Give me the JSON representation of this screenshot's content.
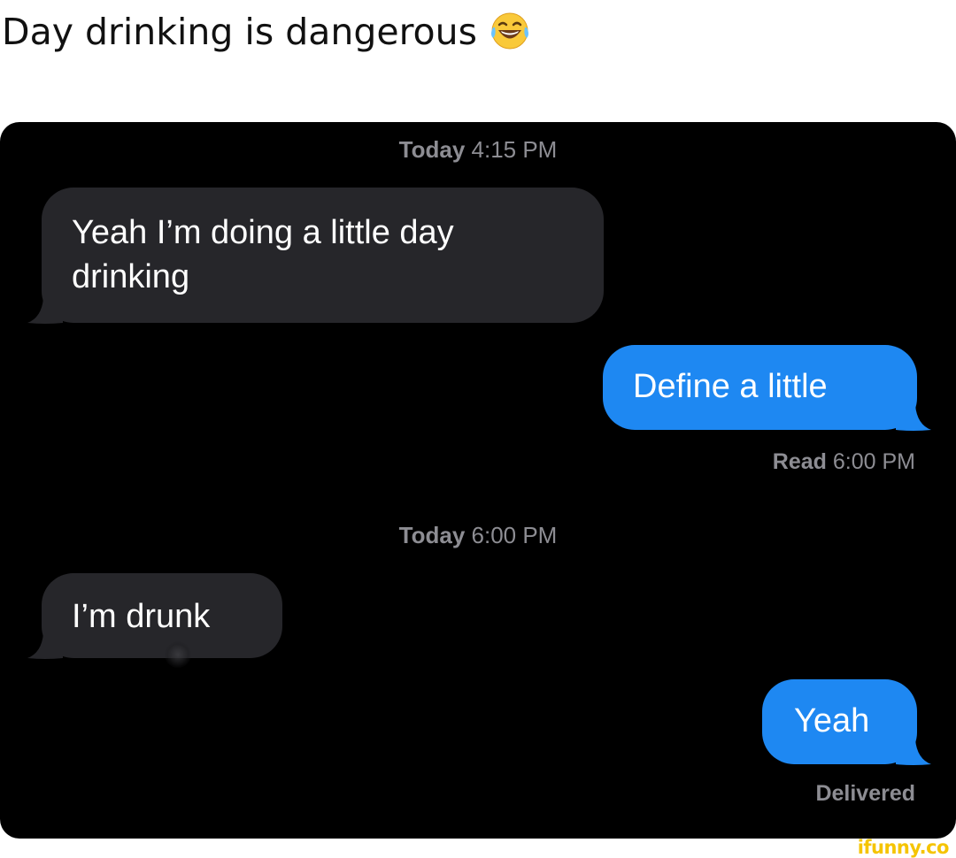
{
  "caption": {
    "text": "Day drinking is dangerous",
    "emoji_icon": "laughing-tears-emoji"
  },
  "conversation": {
    "timestamp_1": {
      "day": "Today",
      "time": "4:15 PM"
    },
    "message_1": {
      "direction": "incoming",
      "line_1": "Yeah I’m doing a little day",
      "line_2": "drinking"
    },
    "message_2": {
      "direction": "outgoing",
      "text": "Define a little"
    },
    "receipt_1": {
      "status": "Read",
      "time": "6:00 PM"
    },
    "timestamp_2": {
      "day": "Today",
      "time": "6:00 PM"
    },
    "message_3": {
      "direction": "incoming",
      "text": "I’m drunk"
    },
    "message_4": {
      "direction": "outgoing",
      "text": "Yeah"
    },
    "receipt_2": {
      "status": "Delivered"
    }
  },
  "watermark": {
    "text": "ifunny.co"
  },
  "colors": {
    "incoming_bubble": "#26262a",
    "outgoing_bubble": "#1e88f2",
    "background": "#000000",
    "meta_text": "#8d8d93",
    "watermark": "#f5c400"
  }
}
